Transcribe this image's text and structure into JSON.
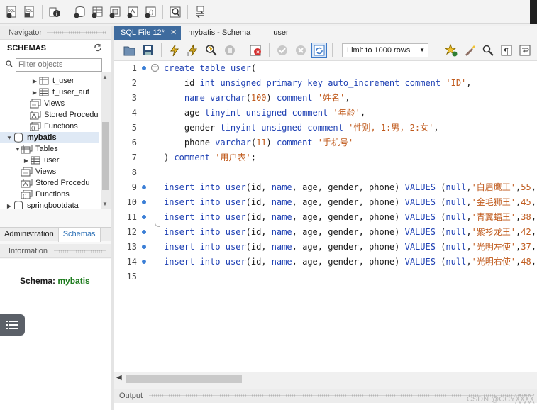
{
  "top_toolbar": {
    "icons": [
      "new-sql-tab-icon",
      "open-sql-file-icon",
      "inspector-icon",
      "create-schema-icon",
      "create-table-icon",
      "create-view-icon",
      "create-procedure-icon",
      "create-function-icon",
      "search-table-data-icon",
      "reconnect-icon"
    ]
  },
  "navigator": {
    "header": "Navigator",
    "schemas_label": "SCHEMAS",
    "filter_placeholder": "Filter objects",
    "tree": [
      {
        "label": "t_user",
        "indent": 3,
        "icon": "table-icon",
        "arrow": "▶"
      },
      {
        "label": "t_user_aut",
        "indent": 3,
        "icon": "table-icon",
        "arrow": "▶"
      },
      {
        "label": "Views",
        "indent": 2,
        "icon": "views-icon",
        "arrow": ""
      },
      {
        "label": "Stored Procedu",
        "indent": 2,
        "icon": "procedures-icon",
        "arrow": ""
      },
      {
        "label": "Functions",
        "indent": 2,
        "icon": "functions-icon",
        "arrow": ""
      },
      {
        "label": "mybatis",
        "indent": 0,
        "icon": "database-icon",
        "arrow": "▼",
        "bold": true,
        "selected": true
      },
      {
        "label": "Tables",
        "indent": 1,
        "icon": "tables-icon",
        "arrow": "▼"
      },
      {
        "label": "user",
        "indent": 2,
        "icon": "table-icon",
        "arrow": "▶"
      },
      {
        "label": "Views",
        "indent": 1,
        "icon": "views-icon",
        "arrow": ""
      },
      {
        "label": "Stored Procedu",
        "indent": 1,
        "icon": "procedures-icon",
        "arrow": ""
      },
      {
        "label": "Functions",
        "indent": 1,
        "icon": "functions-icon",
        "arrow": ""
      },
      {
        "label": "springbootdata",
        "indent": 0,
        "icon": "database-icon",
        "arrow": "▶"
      }
    ],
    "tabs": [
      "Administration",
      "Schemas"
    ],
    "active_tab": "Schemas"
  },
  "information": {
    "header": "Information",
    "schema_label": "Schema:",
    "schema_value": "mybatis"
  },
  "editor": {
    "tabs": [
      {
        "label": "SQL File 12*",
        "active": true
      },
      {
        "label": "mybatis - Schema",
        "active": false
      },
      {
        "label": "user",
        "active": false
      }
    ],
    "toolbar_icons": [
      "open-file-icon",
      "save-icon",
      "execute-icon",
      "execute-current-icon",
      "explain-icon",
      "stop-icon",
      "toggle-error-icon",
      "commit-icon",
      "rollback-icon",
      "autocommit-icon"
    ],
    "limit_value": "Limit to 1000 rows",
    "toolbar_icons_right": [
      "add-snippet-icon",
      "beautify-icon",
      "find-icon",
      "invisible-chars-icon",
      "wrap-lines-icon"
    ],
    "lines": [
      {
        "n": "1",
        "dot": true,
        "fold": "⊖",
        "html": "<span class='k'>create table</span> <span class='n'>user</span>("
      },
      {
        "n": "2",
        "dot": false,
        "html": "    id <span class='k'>int unsigned primary key auto_increment comment</span> <span class='s'>'ID'</span>,"
      },
      {
        "n": "3",
        "dot": false,
        "html": "    <span class='n'>name</span> <span class='k'>varchar</span>(<span class='s'>100</span>) <span class='k'>comment</span> <span class='s'>'姓名'</span>,"
      },
      {
        "n": "4",
        "dot": false,
        "html": "    age <span class='k'>tinyint unsigned comment</span> <span class='s'>'年龄'</span>,"
      },
      {
        "n": "5",
        "dot": false,
        "html": "    gender <span class='k'>tinyint unsigned comment</span> <span class='s'>'性别, 1:男, 2:女'</span>,"
      },
      {
        "n": "6",
        "dot": false,
        "html": "    phone <span class='k'>varchar</span>(<span class='s'>11</span>) <span class='k'>comment</span> <span class='s'>'手机号'</span>"
      },
      {
        "n": "7",
        "dot": false,
        "html": ") <span class='k'>comment</span> <span class='s'>'用户表'</span>;"
      },
      {
        "n": "8",
        "dot": false,
        "html": ""
      },
      {
        "n": "9",
        "dot": true,
        "html": "<span class='k'>insert into</span> <span class='n'>user</span>(id, <span class='n'>name</span>, age, gender, phone) <span class='k'>VALUES</span> (<span class='k'>null</span>,<span class='s'>'白眉鹰王'</span>,<span class='s'>55</span>,'"
      },
      {
        "n": "10",
        "dot": true,
        "html": "<span class='k'>insert into</span> <span class='n'>user</span>(id, <span class='n'>name</span>, age, gender, phone) <span class='k'>VALUES</span> (<span class='k'>null</span>,<span class='s'>'金毛狮王'</span>,<span class='s'>45</span>,'"
      },
      {
        "n": "11",
        "dot": true,
        "html": "<span class='k'>insert into</span> <span class='n'>user</span>(id, <span class='n'>name</span>, age, gender, phone) <span class='k'>VALUES</span> (<span class='k'>null</span>,<span class='s'>'青翼蝠王'</span>,<span class='s'>38</span>,'"
      },
      {
        "n": "12",
        "dot": true,
        "html": "<span class='k'>insert into</span> <span class='n'>user</span>(id, <span class='n'>name</span>, age, gender, phone) <span class='k'>VALUES</span> (<span class='k'>null</span>,<span class='s'>'紫衫龙王'</span>,<span class='s'>42</span>,'"
      },
      {
        "n": "13",
        "dot": true,
        "html": "<span class='k'>insert into</span> <span class='n'>user</span>(id, <span class='n'>name</span>, age, gender, phone) <span class='k'>VALUES</span> (<span class='k'>null</span>,<span class='s'>'光明左使'</span>,<span class='s'>37</span>,'"
      },
      {
        "n": "14",
        "dot": true,
        "html": "<span class='k'>insert into</span> <span class='n'>user</span>(id, <span class='n'>name</span>, age, gender, phone) <span class='k'>VALUES</span> (<span class='k'>null</span>,<span class='s'>'光明右使'</span>,<span class='s'>48</span>,'"
      },
      {
        "n": "15",
        "dot": false,
        "html": ""
      }
    ]
  },
  "output": {
    "header": "Output"
  },
  "watermark": "CSDN @CCY╳╳╳╳"
}
